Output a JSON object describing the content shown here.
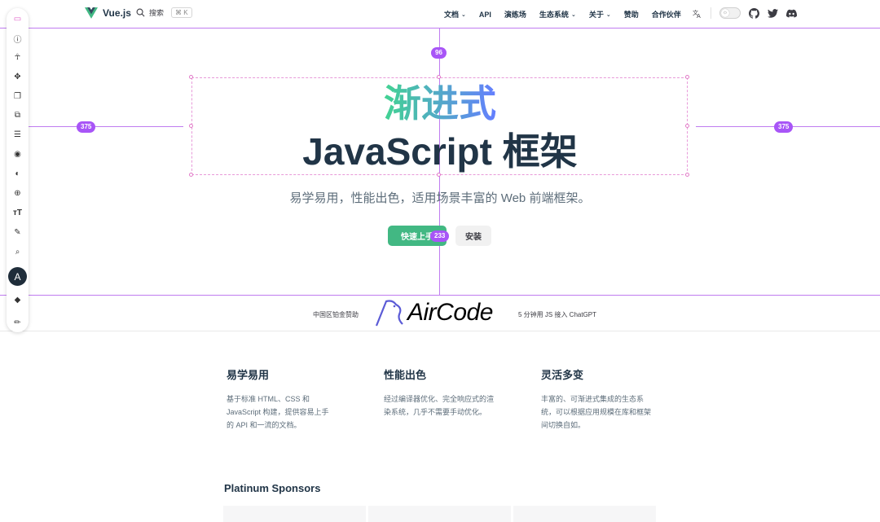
{
  "header": {
    "logo_text": "Vue.js",
    "search_label": "搜索",
    "search_shortcut": "⌘ K",
    "nav": [
      {
        "label": "文档",
        "has_dropdown": true
      },
      {
        "label": "API",
        "has_dropdown": false
      },
      {
        "label": "演练场",
        "has_dropdown": false
      },
      {
        "label": "生态系统",
        "has_dropdown": true
      },
      {
        "label": "关于",
        "has_dropdown": true
      },
      {
        "label": "赞助",
        "has_dropdown": false
      },
      {
        "label": "合作伙伴",
        "has_dropdown": false
      }
    ],
    "icons": [
      "translate-icon",
      "theme-toggle",
      "github-icon",
      "twitter-icon",
      "discord-icon"
    ]
  },
  "toolbar": {
    "tools": [
      "ruler-icon",
      "info-icon",
      "accessibility-icon",
      "move-icon",
      "layers-icon",
      "copy-icon",
      "align-icon",
      "palette-icon",
      "contrast-icon",
      "spacing-icon",
      "typography-icon",
      "pen-icon",
      "search-icon"
    ],
    "avatar_letter": "A",
    "bottom_tools": [
      "fill-icon",
      "edit-icon"
    ]
  },
  "measurements": {
    "top": "96",
    "left": "375",
    "right": "375",
    "bottom": "233"
  },
  "hero": {
    "title_line1": "渐进式",
    "title_line2": "JavaScript 框架",
    "tagline": "易学易用，性能出色，适用场景丰富的 Web 前端框架。",
    "primary_button": "快速上手",
    "secondary_button": "安装"
  },
  "sponsor": {
    "label": "中国区铂金赞助",
    "logo_text": "AirCode",
    "description": "5 分钟用 JS 接入 ChatGPT"
  },
  "features": [
    {
      "title": "易学易用",
      "text": "基于标准 HTML、CSS 和 JavaScript 构建，提供容易上手的 API 和一流的文档。"
    },
    {
      "title": "性能出色",
      "text": "经过编译器优化、完全响应式的渲染系统，几乎不需要手动优化。"
    },
    {
      "title": "灵活多变",
      "text": "丰富的、可渐进式集成的生态系统，可以根据应用规模在库和框架间切换自如。"
    }
  ],
  "platinum": {
    "title": "Platinum Sponsors"
  },
  "colors": {
    "brand_green": "#42b883",
    "text_dark": "#213547",
    "gradient_start": "#42d392",
    "gradient_end": "#647eff",
    "guide_purple": "#a855f7"
  }
}
